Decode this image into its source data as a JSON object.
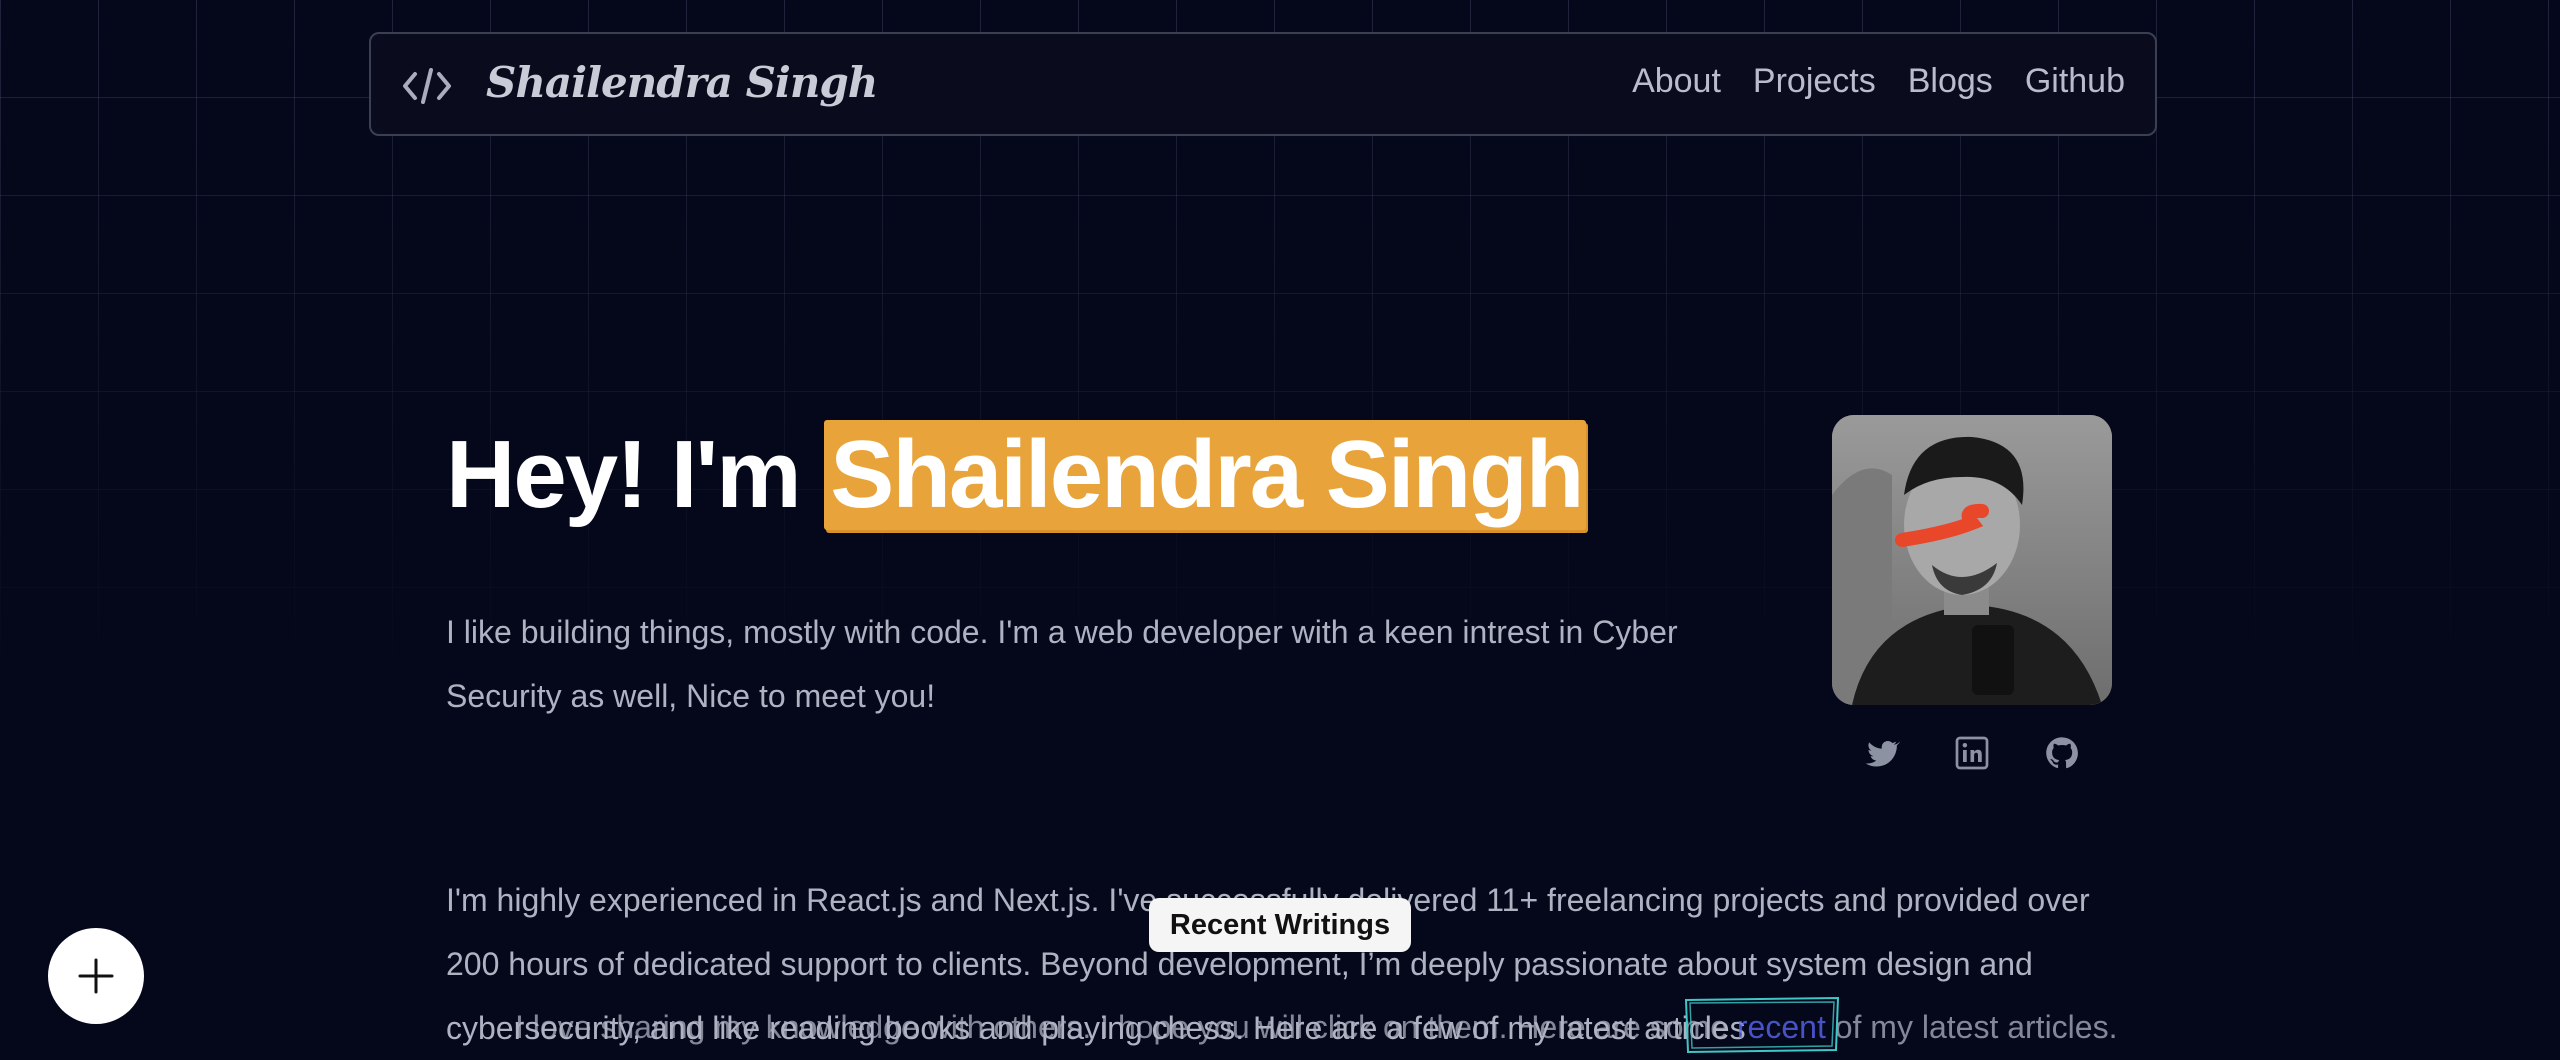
{
  "nav": {
    "brand": "Shailendra Singh",
    "logo_icon": "code-brackets-icon",
    "links": [
      "About",
      "Projects",
      "Blogs",
      "Github"
    ]
  },
  "hero": {
    "greeting": "Hey! I'm ",
    "name": "Shailendra Singh",
    "intro": "I like building things, mostly with code. I'm a web developer with a keen intrest in Cyber Security as well, Nice to meet you!"
  },
  "socials": [
    {
      "name": "twitter-icon"
    },
    {
      "name": "linkedin-icon"
    },
    {
      "name": "github-icon"
    }
  ],
  "about": {
    "paragraph": "I'm highly experienced in React.js and Next.js. I've successfully delivered 11+ freelancing projects and provided over 200 hours of dedicated support to clients. Beyond development, I’m deeply passionate about system design and cybersecurity, and like reading books and playing chess. Here are a few of my latest articles",
    "overlay_text_before": "I love sharing my knowledge with others. I hope you will click on them. Here are some ",
    "overlay_link": "recent",
    "overlay_text_after": " of my latest articles."
  },
  "floating": {
    "recent_writings_label": "Recent Writings",
    "add_icon": "plus-icon"
  },
  "colors": {
    "background": "#05071a",
    "highlight": "#e8a33a",
    "link": "#5e6bff",
    "scribble": "#3fc7c7",
    "accent_mark": "#e8472a"
  }
}
